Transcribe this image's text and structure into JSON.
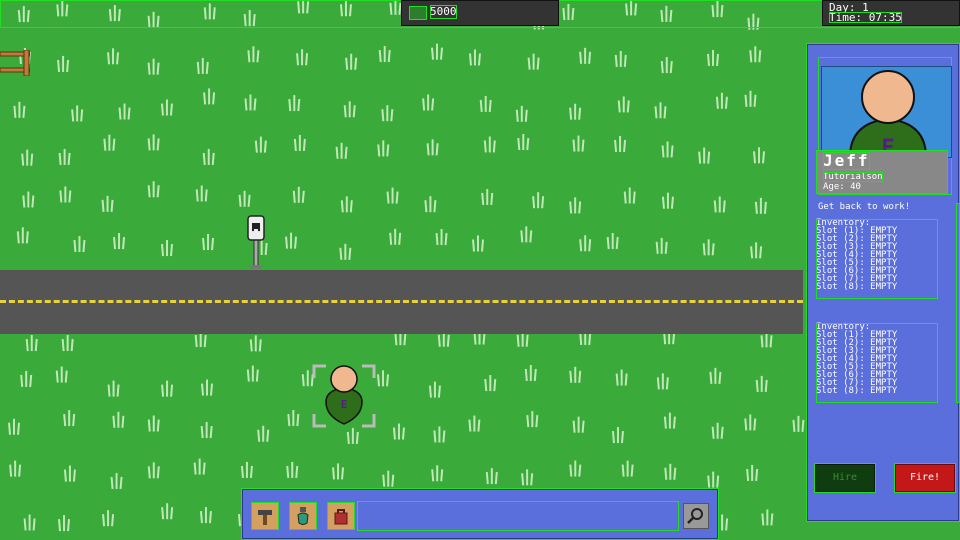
{
  "hud": {
    "money": "5000",
    "day": "Day: 1",
    "time": "Time: 07:35"
  },
  "worker_panel": {
    "name": "Jeff",
    "role": "Tutorialson",
    "age": "Age: 40",
    "status": "Get back to work!",
    "inventories": [
      {
        "title": "Inventory:",
        "slots": [
          "Slot (1): EMPTY",
          "Slot (2): EMPTY",
          "Slot (3): EMPTY",
          "Slot (4): EMPTY",
          "Slot (5): EMPTY",
          "Slot (6): EMPTY",
          "Slot (7): EMPTY",
          "Slot (8): EMPTY"
        ]
      },
      {
        "title": "Inventory:",
        "slots": [
          "Slot (1): EMPTY",
          "Slot (2): EMPTY",
          "Slot (3): EMPTY",
          "Slot (4): EMPTY",
          "Slot (5): EMPTY",
          "Slot (6): EMPTY",
          "Slot (7): EMPTY",
          "Slot (8): EMPTY"
        ]
      }
    ],
    "hire_label": "Hire",
    "fire_label": "Fire!"
  },
  "toolbar": {
    "tools": [
      "hammer-icon",
      "potion-icon",
      "bag-icon"
    ],
    "search_icon": "magnifier-icon"
  },
  "colors": {
    "grass": "#3aaa3a",
    "road": "#555555",
    "road_line": "#e8d23a",
    "panel": "#5b6fdc",
    "fire": "#c41818",
    "hire": "#0f3d0f"
  }
}
